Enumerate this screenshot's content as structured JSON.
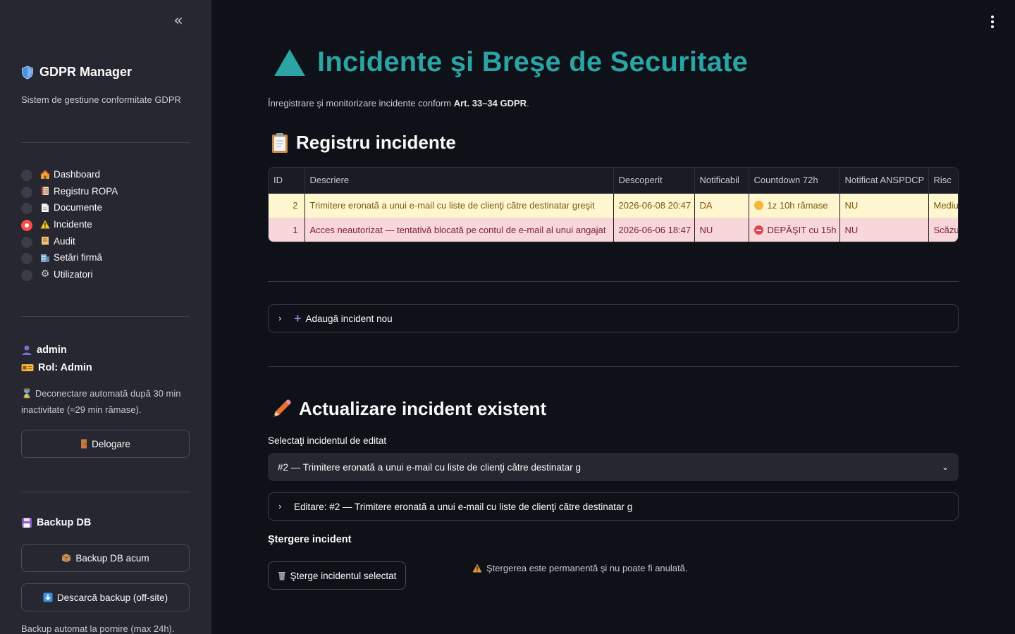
{
  "sidebar": {
    "brand_title": "GDPR Manager",
    "brand_subtitle": "Sistem de gestiune conformitate GDPR",
    "nav": [
      {
        "label": "Dashboard",
        "icon": "house-icon",
        "selected": false
      },
      {
        "label": "Registru ROPA",
        "icon": "ledger-icon",
        "selected": false
      },
      {
        "label": "Documente",
        "icon": "document-icon",
        "selected": false
      },
      {
        "label": "Incidente",
        "icon": "warning-icon",
        "selected": true
      },
      {
        "label": "Audit",
        "icon": "receipt-icon",
        "selected": false
      },
      {
        "label": "Setări firmă",
        "icon": "office-building-icon",
        "selected": false
      },
      {
        "label": "Utilizatori",
        "icon": "gear-icon",
        "selected": false
      }
    ],
    "user": {
      "name": "admin",
      "role": "Rol: Admin"
    },
    "session_note": "Deconectare automată după 30 min inactivitate (≈29 min rămase).",
    "logout_label": "Delogare",
    "backup": {
      "title": "Backup DB",
      "backup_now_label": "Backup DB acum",
      "download_label": "Descarcă backup (off-site)",
      "note": "Backup automat la pornire (max 24h)."
    }
  },
  "main": {
    "title": "Incidente şi Breşe de Securitate",
    "subtitle_prefix": "Înregistrare şi monitorizare incidente conform ",
    "subtitle_bold": "Art. 33–34 GDPR",
    "subtitle_suffix": ".",
    "registry_title": "Registru incidente",
    "table": {
      "columns": [
        "ID",
        "Descriere",
        "Descoperit",
        "Notificabil",
        "Countdown 72h",
        "Notificat ANSPDCP",
        "Risc"
      ],
      "rows": [
        {
          "id": "2",
          "description": "Trimitere eronată a unui e-mail cu liste de clienţi către destinatar greşit",
          "discovered": "2026-06-08 20:47",
          "notifiable": "DA",
          "countdown": "1z 10h rămase",
          "notified": "NU",
          "risk": "Mediu",
          "status": "yellow"
        },
        {
          "id": "1",
          "description": "Acces neautorizat — tentativă blocată pe contul de e-mail al unui angajat",
          "discovered": "2026-06-06 18:47",
          "notifiable": "NU",
          "countdown": "DEPĂŞIT cu 15h",
          "notified": "NU",
          "risk": "Scăzut",
          "status": "red"
        }
      ]
    },
    "add_expander_label": "Adaugă incident nou",
    "update_title": "Actualizare incident existent",
    "select_label": "Selectaţi incidentul de editat",
    "select_value": "#2 — Trimitere eronată a unui e-mail cu liste de clienţi către destinatar g",
    "edit_expander_label": "Editare: #2 — Trimitere eronată a unui e-mail cu liste de clienţi către destinatar g",
    "delete_title": "Ştergere incident",
    "delete_button_label": "Şterge incidentul selectat",
    "delete_warning": "Ştergerea este permanentă şi nu poate fi anulată."
  }
}
